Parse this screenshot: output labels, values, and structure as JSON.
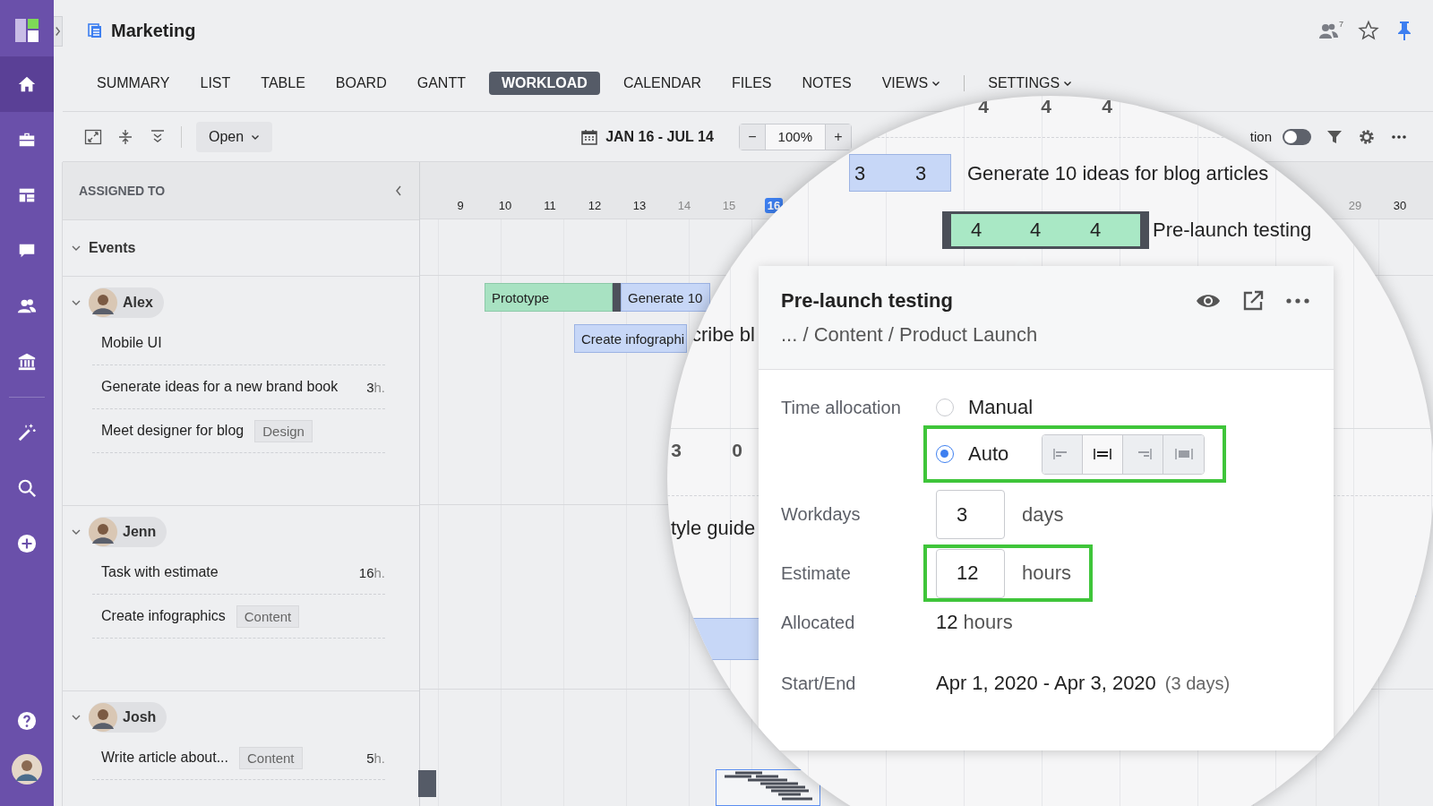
{
  "sidebar": {
    "items": [
      {
        "selected": true
      },
      {
        "selected": false
      },
      {
        "selected": false
      },
      {
        "selected": false
      },
      {
        "selected": false
      },
      {
        "selected": false
      },
      {
        "selected": false
      },
      {
        "selected": false
      },
      {
        "selected": false
      },
      {
        "selected": false
      }
    ]
  },
  "header": {
    "title": "Marketing",
    "members_count": "7",
    "pinned": true
  },
  "tabs": [
    {
      "label": "SUMMARY",
      "selected": false,
      "has_menu": false
    },
    {
      "label": "LIST",
      "selected": false,
      "has_menu": false
    },
    {
      "label": "TABLE",
      "selected": false,
      "has_menu": false
    },
    {
      "label": "BOARD",
      "selected": false,
      "has_menu": false
    },
    {
      "label": "GANTT",
      "selected": false,
      "has_menu": false
    },
    {
      "label": "WORKLOAD",
      "selected": true,
      "has_menu": false
    },
    {
      "label": "CALENDAR",
      "selected": false,
      "has_menu": false
    },
    {
      "label": "FILES",
      "selected": false,
      "has_menu": false
    },
    {
      "label": "NOTES",
      "selected": false,
      "has_menu": false
    },
    {
      "label": "VIEWS",
      "selected": false,
      "has_menu": true
    },
    {
      "label": "SETTINGS",
      "selected": false,
      "has_menu": true
    }
  ],
  "toolbar": {
    "open_button": "Open",
    "date_range": "JAN 16 - JUL 14",
    "zoom_minus": "−",
    "zoom": "100%",
    "zoom_plus": "+",
    "toggle_label": "tion",
    "toggle_on": false
  },
  "panel": {
    "header": "ASSIGNED TO",
    "events_label": "Events",
    "events_expanded": true,
    "people": [
      {
        "name": "Alex",
        "expanded": true,
        "tasks": [
          {
            "title": "Mobile UI"
          },
          {
            "title": "Generate ideas for a new brand book",
            "estimate": "3",
            "unit": "h."
          },
          {
            "title": "Meet designer for blog",
            "tag": "Design"
          }
        ]
      },
      {
        "name": "Jenn",
        "expanded": true,
        "tasks": [
          {
            "title": "Task with estimate",
            "estimate": "16",
            "unit": "h."
          },
          {
            "title": "Create infographics",
            "tag": "Content"
          }
        ]
      },
      {
        "name": "Josh",
        "expanded": true,
        "tasks": [
          {
            "title": "Write article about...",
            "tag": "Content",
            "estimate": "5",
            "unit": "h."
          }
        ]
      }
    ]
  },
  "timeline": {
    "days_left": [
      {
        "label": "9",
        "weekend": false,
        "today": false
      },
      {
        "label": "10",
        "weekend": false,
        "today": false
      },
      {
        "label": "11",
        "weekend": false,
        "today": false
      },
      {
        "label": "12",
        "weekend": false,
        "today": false
      },
      {
        "label": "13",
        "weekend": false,
        "today": false
      },
      {
        "label": "14",
        "weekend": true,
        "today": false
      },
      {
        "label": "15",
        "weekend": true,
        "today": false
      },
      {
        "label": "16",
        "weekend": false,
        "today": true
      }
    ],
    "days_right": [
      {
        "label": "29",
        "weekend": true,
        "today": false
      },
      {
        "label": "30",
        "weekend": false,
        "today": false
      }
    ],
    "bars": [
      {
        "label": "Prototype",
        "kind": "green"
      },
      {
        "label": "Generate 10",
        "kind": "blue"
      },
      {
        "label": "Create infographi",
        "kind": "blue"
      }
    ]
  },
  "magnifier": {
    "top_numbers": [
      "4",
      "4",
      "4"
    ],
    "bars": [
      {
        "kind": "blue",
        "numbers": [
          "3",
          "3"
        ],
        "label": "Generate 10 ideas for blog articles"
      },
      {
        "kind": "green",
        "numbers": [
          "4",
          "4",
          "4"
        ],
        "label": "Pre-launch testing"
      }
    ],
    "fragments": [
      "cribe bl",
      "tyle guide"
    ],
    "workload_numbers": [
      "3",
      "0"
    ]
  },
  "popup": {
    "title": "Pre-launch testing",
    "breadcrumb": "... / Content / Product Launch",
    "allocation": {
      "label": "Time allocation",
      "highlighted": true,
      "options": [
        {
          "label": "Manual",
          "selected": false
        },
        {
          "label": "Auto",
          "selected": true
        }
      ],
      "modes": [
        {
          "selected": false
        },
        {
          "selected": true
        },
        {
          "selected": false
        },
        {
          "selected": false
        }
      ]
    },
    "workdays": {
      "label": "Workdays",
      "value": "3",
      "unit": "days"
    },
    "estimate": {
      "label": "Estimate",
      "value": "12",
      "unit": "hours",
      "highlighted": true
    },
    "allocated": {
      "label": "Allocated",
      "value": "12",
      "unit": "hours"
    },
    "start_end": {
      "label": "Start/End",
      "value": "Apr 1, 2020 - Apr 3, 2020",
      "note": "(3 days)"
    }
  }
}
